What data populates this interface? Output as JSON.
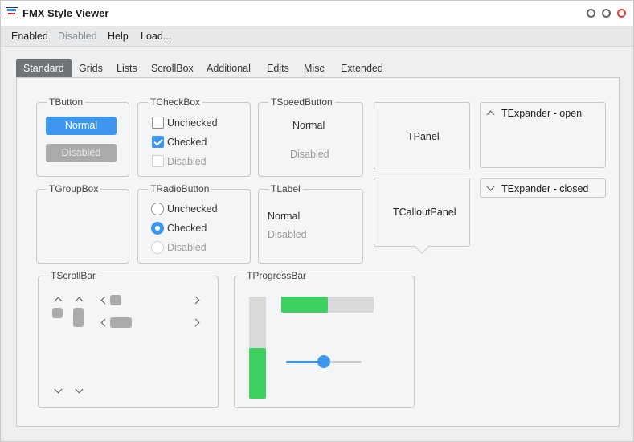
{
  "window": {
    "title": "FMX Style Viewer"
  },
  "menu": [
    {
      "label": "Enabled",
      "disabled": false
    },
    {
      "label": "Disabled",
      "disabled": true
    },
    {
      "label": "Help",
      "disabled": false
    },
    {
      "label": "Load...",
      "disabled": false
    }
  ],
  "tabs": [
    "Standard",
    "Grids",
    "Lists",
    "ScrollBox",
    "Additional",
    "Edits",
    "Misc",
    "Extended"
  ],
  "active_tab": "Standard",
  "tbutton": {
    "title": "TButton",
    "normal": "Normal",
    "disabled": "Disabled"
  },
  "tcheckbox": {
    "title": "TCheckBox",
    "unchecked": "Unchecked",
    "checked": "Checked",
    "disabled": "Disabled"
  },
  "tspeedbutton": {
    "title": "TSpeedButton",
    "normal": "Normal",
    "disabled": "Disabled"
  },
  "tpanel": {
    "label": "TPanel"
  },
  "texpander_open": {
    "label": "TExpander - open"
  },
  "texpander_closed": {
    "label": "TExpander - closed"
  },
  "tgroupbox": {
    "title": "TGroupBox"
  },
  "tradiobutton": {
    "title": "TRadioButton",
    "unchecked": "Unchecked",
    "checked": "Checked",
    "disabled": "Disabled"
  },
  "tlabel": {
    "title": "TLabel",
    "normal": "Normal",
    "disabled": "Disabled"
  },
  "tcalloutpanel": {
    "label": "TCalloutPanel"
  },
  "tscrollbar": {
    "title": "TScrollBar"
  },
  "tprogressbar": {
    "title": "TProgressBar",
    "horizontal_progress": 0.5,
    "vertical_progress": 0.5,
    "trackbar_value": 0.5
  },
  "colors": {
    "accent": "#3d97ef",
    "progress": "#3fd160",
    "active_tab": "#6f7478",
    "close_button": "#e04040"
  }
}
